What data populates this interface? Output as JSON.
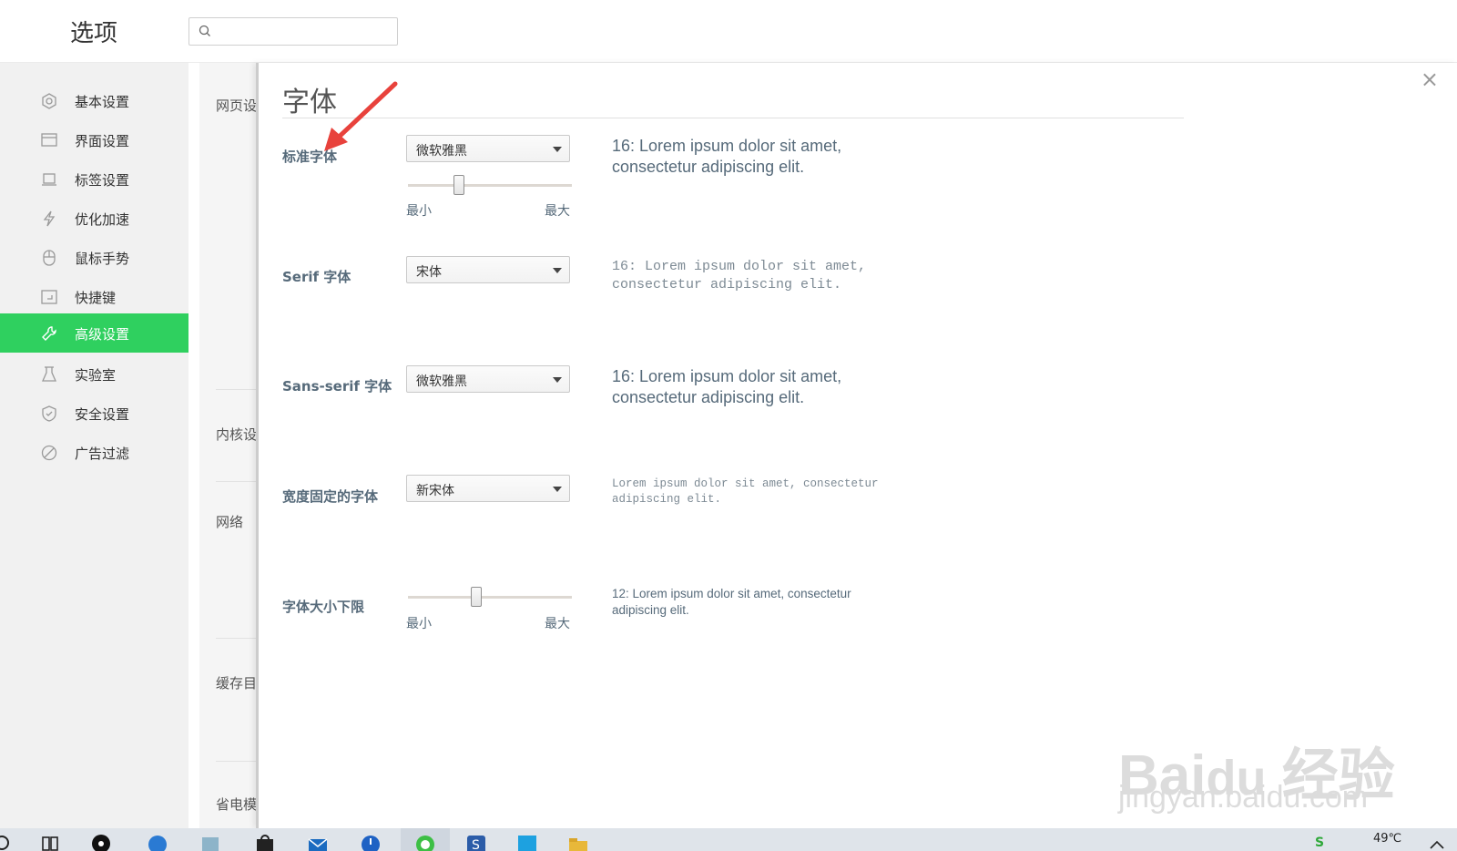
{
  "header": {
    "title": "选项",
    "search_placeholder": ""
  },
  "sidebar": {
    "items": [
      {
        "label": "基本设置",
        "icon": "gear-outline-icon"
      },
      {
        "label": "界面设置",
        "icon": "window-icon"
      },
      {
        "label": "标签设置",
        "icon": "tab-icon"
      },
      {
        "label": "优化加速",
        "icon": "lightning-icon"
      },
      {
        "label": "鼠标手势",
        "icon": "mouse-icon"
      },
      {
        "label": "快捷键",
        "icon": "keyboard-icon"
      },
      {
        "label": "高级设置",
        "icon": "wrench-icon",
        "active": true
      },
      {
        "label": "实验室",
        "icon": "flask-icon"
      },
      {
        "label": "安全设置",
        "icon": "shield-icon"
      },
      {
        "label": "广告过滤",
        "icon": "block-icon"
      }
    ]
  },
  "background_page": {
    "sections": [
      "网页设",
      "内核设",
      "网络",
      "缓存目",
      "省电模"
    ]
  },
  "dialog": {
    "title": "字体",
    "close_label": "×",
    "rows": {
      "standard": {
        "label": "标准字体",
        "select_value": "微软雅黑",
        "slider_min": "最小",
        "slider_max": "最大",
        "slider_level": 0.3,
        "preview": "16: Lorem ipsum dolor sit amet, consectetur adipiscing elit."
      },
      "serif": {
        "label": "Serif 字体",
        "select_value": "宋体",
        "preview": "16: Lorem ipsum dolor sit amet, consectetur adipiscing elit."
      },
      "sans": {
        "label": "Sans-serif 字体",
        "select_value": "微软雅黑",
        "preview": "16: Lorem ipsum dolor sit amet, consectetur adipiscing elit."
      },
      "mono": {
        "label": "宽度固定的字体",
        "select_value": "新宋体",
        "preview": "Lorem ipsum dolor sit amet, consectetur adipiscing elit."
      },
      "minsize": {
        "label": "字体大小下限",
        "slider_min": "最小",
        "slider_max": "最大",
        "slider_level": 0.41,
        "preview": "12: Lorem ipsum dolor sit amet, consectetur adipiscing elit."
      }
    }
  },
  "taskbar": {
    "temperature": "49℃"
  },
  "colors": {
    "accent": "#2fd05f",
    "label_text": "#566a7a",
    "annotation_arrow": "#e8423c"
  }
}
